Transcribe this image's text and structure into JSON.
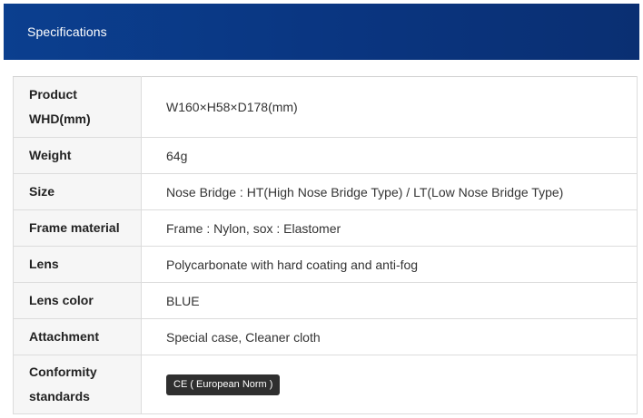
{
  "header": {
    "title": "Specifications"
  },
  "specs": [
    {
      "label": "Product WHD(mm)",
      "value": "W160×H58×D178(mm)"
    },
    {
      "label": "Weight",
      "value": "64g"
    },
    {
      "label": "Size",
      "value": "Nose Bridge : HT(High Nose Bridge Type) / LT(Low Nose Bridge Type)"
    },
    {
      "label": "Frame material",
      "value": "Frame : Nylon, sox : Elastomer"
    },
    {
      "label": "Lens",
      "value": "Polycarbonate with hard coating and anti-fog"
    },
    {
      "label": "Lens color",
      "value": "BLUE"
    },
    {
      "label": "Attachment",
      "value": "Special case, Cleaner cloth"
    },
    {
      "label": "Conformity standards",
      "badge": "CE ( European Norm )"
    }
  ],
  "colors": {
    "header_bg": "#0a3580",
    "label_bg": "#f6f6f6",
    "badge_bg": "#2f2f2f"
  }
}
